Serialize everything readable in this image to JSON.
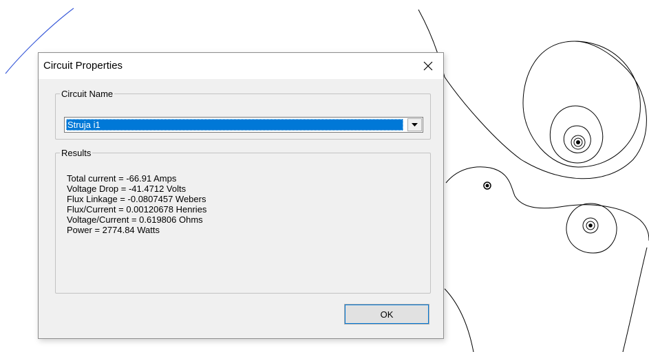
{
  "dialog": {
    "title": "Circuit Properties",
    "close_symbol": "✕"
  },
  "circuit_name_group": {
    "label": "Circuit Name",
    "selected_value": "Struja i1"
  },
  "results_group": {
    "label": "Results",
    "lines": [
      "Total current = -66.91 Amps",
      "Voltage Drop = -41.4712 Volts",
      "Flux Linkage = -0.0807457 Webers",
      "Flux/Current = 0.00120678 Henries",
      "Voltage/Current = 0.619806 Ohms",
      "Power = 2774.84 Watts"
    ]
  },
  "buttons": {
    "ok_label": "OK"
  },
  "icons": {
    "close": "close-icon",
    "dropdown": "chevron-down-icon"
  },
  "colors": {
    "selection": "#0078d7",
    "dialog_bg": "#f0f0f0",
    "backdrop_line": "#000000",
    "accent_line": "#3a5bd9"
  }
}
